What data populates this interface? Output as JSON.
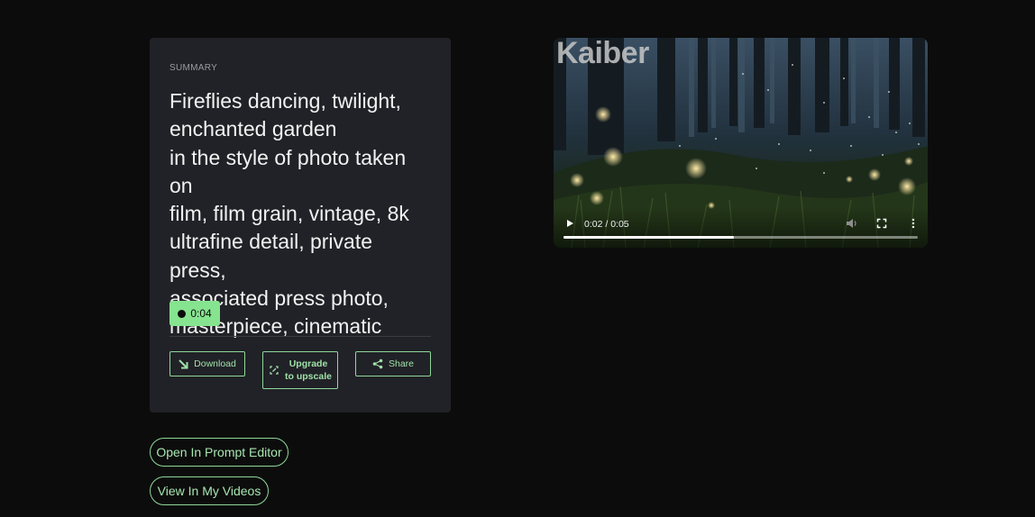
{
  "summary": {
    "label": "SUMMARY",
    "prompt_lines": [
      "Fireflies dancing, twilight,",
      "enchanted garden",
      "in the style of photo taken on",
      "film, film grain, vintage, 8k",
      "ultrafine detail, private press,",
      "associated press photo,",
      "masterpiece, cinematic"
    ],
    "duration": "0:04"
  },
  "actions": {
    "download": "Download",
    "upgrade_line1": "Upgrade",
    "upgrade_line2": "to upscale",
    "share": "Share"
  },
  "links": {
    "open_prompt_editor": "Open In Prompt Editor",
    "view_my_videos": "View In My Videos"
  },
  "video": {
    "watermark": "Kaiber",
    "timecode": "0:02 / 0:05",
    "progress_fraction": 0.48
  },
  "colors": {
    "accent": "#86e38f",
    "card_bg": "#212227",
    "page_bg": "#0c0c0c"
  },
  "icons": [
    "download-icon",
    "upscale-icon",
    "share-icon",
    "play-icon",
    "volume-icon",
    "fullscreen-icon",
    "more-vertical-icon"
  ]
}
